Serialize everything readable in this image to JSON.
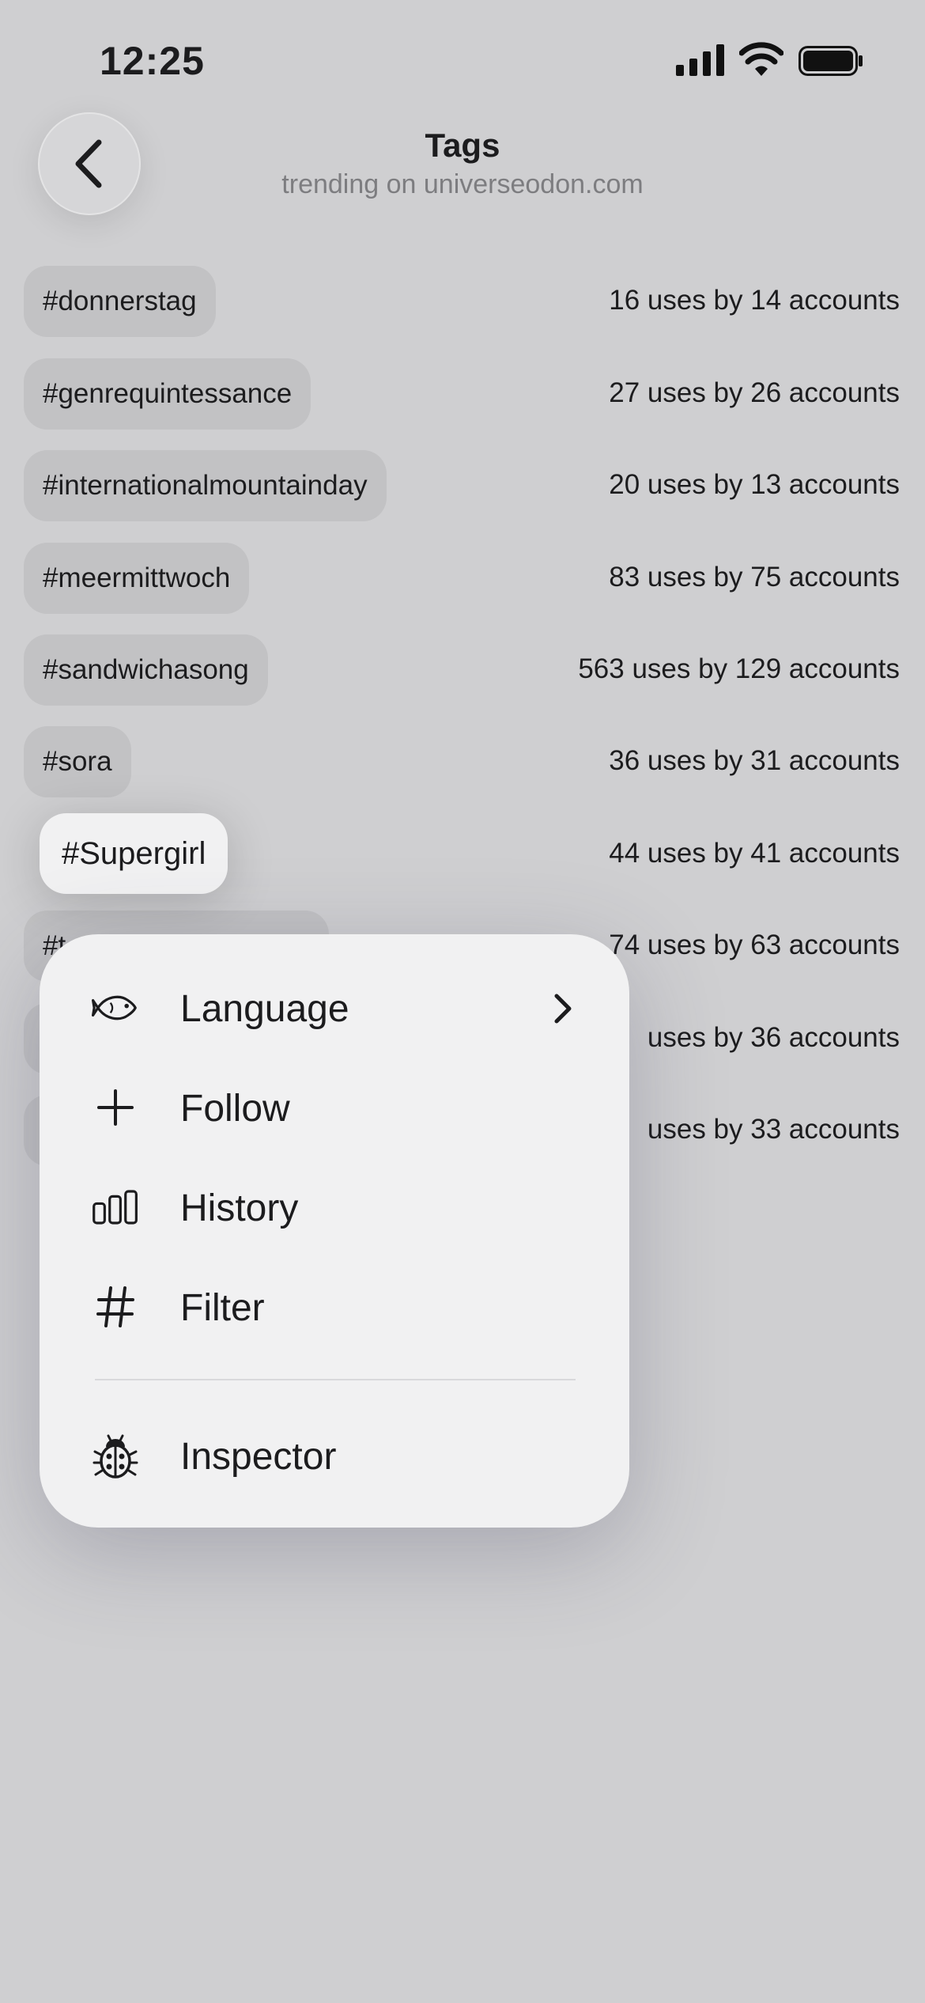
{
  "status_bar": {
    "time": "12:25"
  },
  "header": {
    "title": "Tags",
    "subtitle": "trending on universeodon.com"
  },
  "tags": [
    {
      "name": "#donnerstag",
      "usage": "16 uses by 14 accounts"
    },
    {
      "name": "#genrequintessance",
      "usage": "27 uses by 26 accounts"
    },
    {
      "name": "#internationalmountainday",
      "usage": "20 uses by 13 accounts"
    },
    {
      "name": "#meermittwoch",
      "usage": "83 uses by 75 accounts"
    },
    {
      "name": "#sandwichasong",
      "usage": "563 uses by 129 accounts"
    },
    {
      "name": "#sora",
      "usage": "36 uses by 31 accounts"
    },
    {
      "name": "#Supergirl",
      "usage": "44 uses by 41 accounts"
    },
    {
      "name": "#t",
      "usage": "74 uses by 63 accounts"
    },
    {
      "name": "",
      "usage": "uses by 36 accounts"
    },
    {
      "name": "",
      "usage": "uses by 33 accounts"
    }
  ],
  "context_menu": {
    "items": [
      {
        "label": "Language",
        "icon": "fish-icon",
        "has_submenu": true
      },
      {
        "label": "Follow",
        "icon": "plus-icon"
      },
      {
        "label": "History",
        "icon": "bars-icon"
      },
      {
        "label": "Filter",
        "icon": "hash-icon"
      },
      {
        "label": "Inspector",
        "icon": "ladybug-icon"
      }
    ]
  }
}
